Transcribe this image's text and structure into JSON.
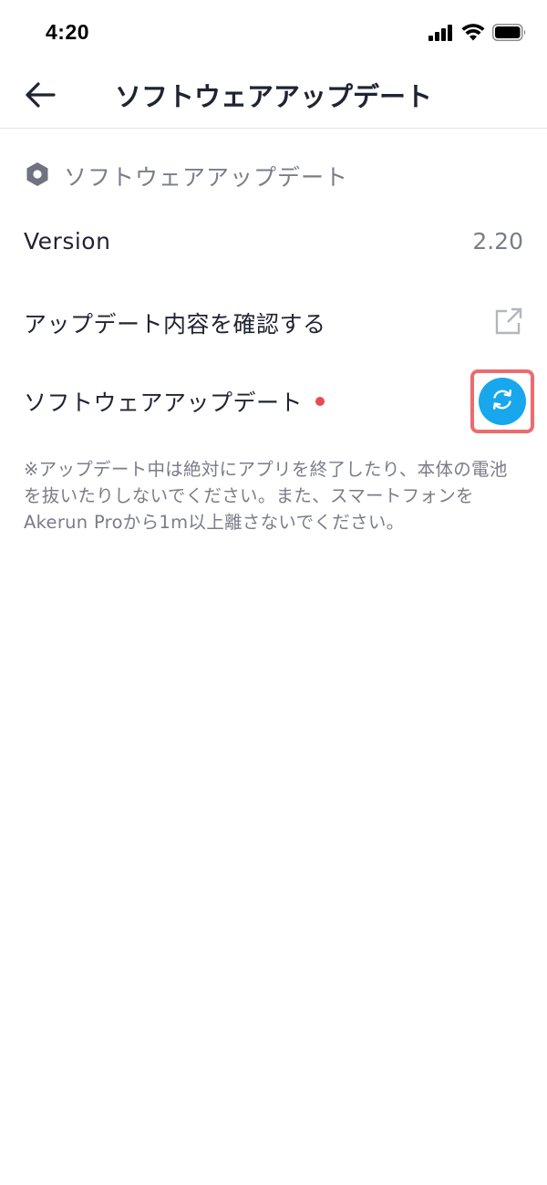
{
  "status_bar": {
    "time": "4:20",
    "icons": [
      "signal-icon",
      "wifi-icon",
      "battery-icon"
    ]
  },
  "nav": {
    "back_icon": "arrow-left-icon",
    "title": "ソフトウェアアップデート"
  },
  "section": {
    "icon": "hexagon-nut-icon",
    "title": "ソフトウェアアップデート"
  },
  "version_row": {
    "label": "Version",
    "value": "2.20"
  },
  "notes_row": {
    "label": "アップデート内容を確認する",
    "icon": "external-link-icon"
  },
  "update_row": {
    "label": "ソフトウェアアップデート",
    "badge_icon": "red-dot",
    "button_icon": "refresh-icon"
  },
  "warning_note": "※アップデート中は絶対にアプリを終了したり、本体の電池を抜いたりしないでください。また、スマートフォンをAkerun Proから1m以上離さないでください。",
  "colors": {
    "accent": "#18a7ec",
    "highlight": "#ee6a6d",
    "badge": "#ea4b50",
    "muted_text": "#7a7d89",
    "primary_text": "#1f2433"
  }
}
